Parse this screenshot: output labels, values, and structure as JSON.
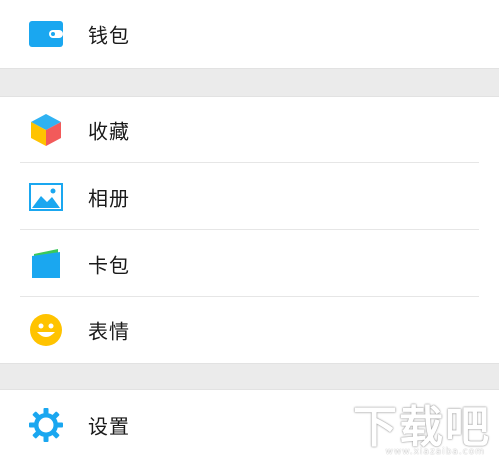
{
  "menu": {
    "wallet": {
      "label": "钱包",
      "icon": "wallet-icon",
      "color": "#1aa7f0"
    },
    "favorites": {
      "label": "收藏",
      "icon": "cube-icon"
    },
    "album": {
      "label": "相册",
      "icon": "picture-icon",
      "color": "#1aa7f0"
    },
    "cards": {
      "label": "卡包",
      "icon": "card-wallet-icon",
      "color": "#1aa7f0"
    },
    "stickers": {
      "label": "表情",
      "icon": "smiley-icon",
      "color": "#ffc300"
    },
    "settings": {
      "label": "设置",
      "icon": "gear-icon",
      "color": "#1aa7f0"
    }
  },
  "watermark": {
    "text": "下载吧",
    "sub": "www.xiazaiba.com"
  }
}
